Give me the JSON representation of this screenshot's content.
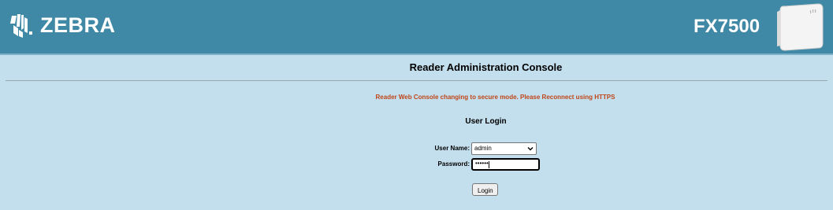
{
  "header": {
    "brand": "ZEBRA",
    "model": "FX7500",
    "colors": {
      "bar": "#3f89a6",
      "background": "#c3deec",
      "warning": "#c0461a"
    }
  },
  "console": {
    "title": "Reader Administration Console"
  },
  "notice": {
    "message": "Reader Web Console changing to secure mode. Please Reconnect using HTTPS"
  },
  "login": {
    "title": "User Login",
    "username_label": "User Name:",
    "username_value": "admin",
    "password_label": "Password:",
    "password_masked": "••••••",
    "button_label": "Login"
  },
  "icons": [
    "zebra-logo-icon",
    "reader-device-icon",
    "chevron-down-icon"
  ]
}
